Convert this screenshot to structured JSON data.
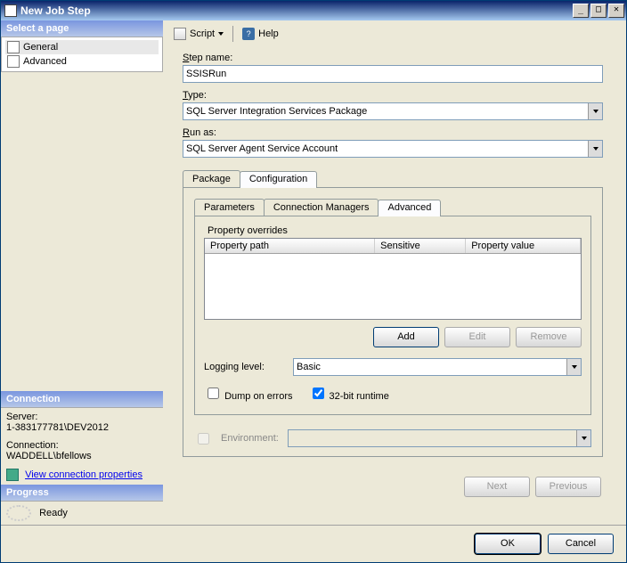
{
  "window": {
    "title": "New Job Step"
  },
  "sidebar": {
    "select_header": "Select a page",
    "pages": [
      {
        "label": "General",
        "active": true
      },
      {
        "label": "Advanced",
        "active": false
      }
    ],
    "connection_header": "Connection",
    "server_label": "Server:",
    "server_value": "1-383177781\\DEV2012",
    "conn_label": "Connection:",
    "conn_value": "WADDELL\\bfellows",
    "view_props_link": "View connection properties",
    "progress_header": "Progress",
    "progress_status": "Ready"
  },
  "toolbar": {
    "script": "Script",
    "help": "Help"
  },
  "form": {
    "step_name_label": "Step name:",
    "step_name_value": "SSISRun",
    "type_label": "Type:",
    "type_value": "SQL Server Integration Services Package",
    "run_as_label": "Run as:",
    "run_as_value": "SQL Server Agent Service Account",
    "tabs": {
      "package": "Package",
      "configuration": "Configuration"
    },
    "inner_tabs": {
      "parameters": "Parameters",
      "conn_mgrs": "Connection Managers",
      "advanced": "Advanced"
    },
    "override_group": "Property overrides",
    "columns": {
      "path": "Property path",
      "sensitive": "Sensitive",
      "value": "Property value"
    },
    "buttons": {
      "add": "Add",
      "edit": "Edit",
      "remove": "Remove"
    },
    "logging_label": "Logging level:",
    "logging_value": "Basic",
    "dump_label": "Dump on errors",
    "runtime_label": "32-bit runtime",
    "env_label": "Environment:",
    "nav": {
      "next": "Next",
      "prev": "Previous"
    }
  },
  "footer": {
    "ok": "OK",
    "cancel": "Cancel"
  }
}
